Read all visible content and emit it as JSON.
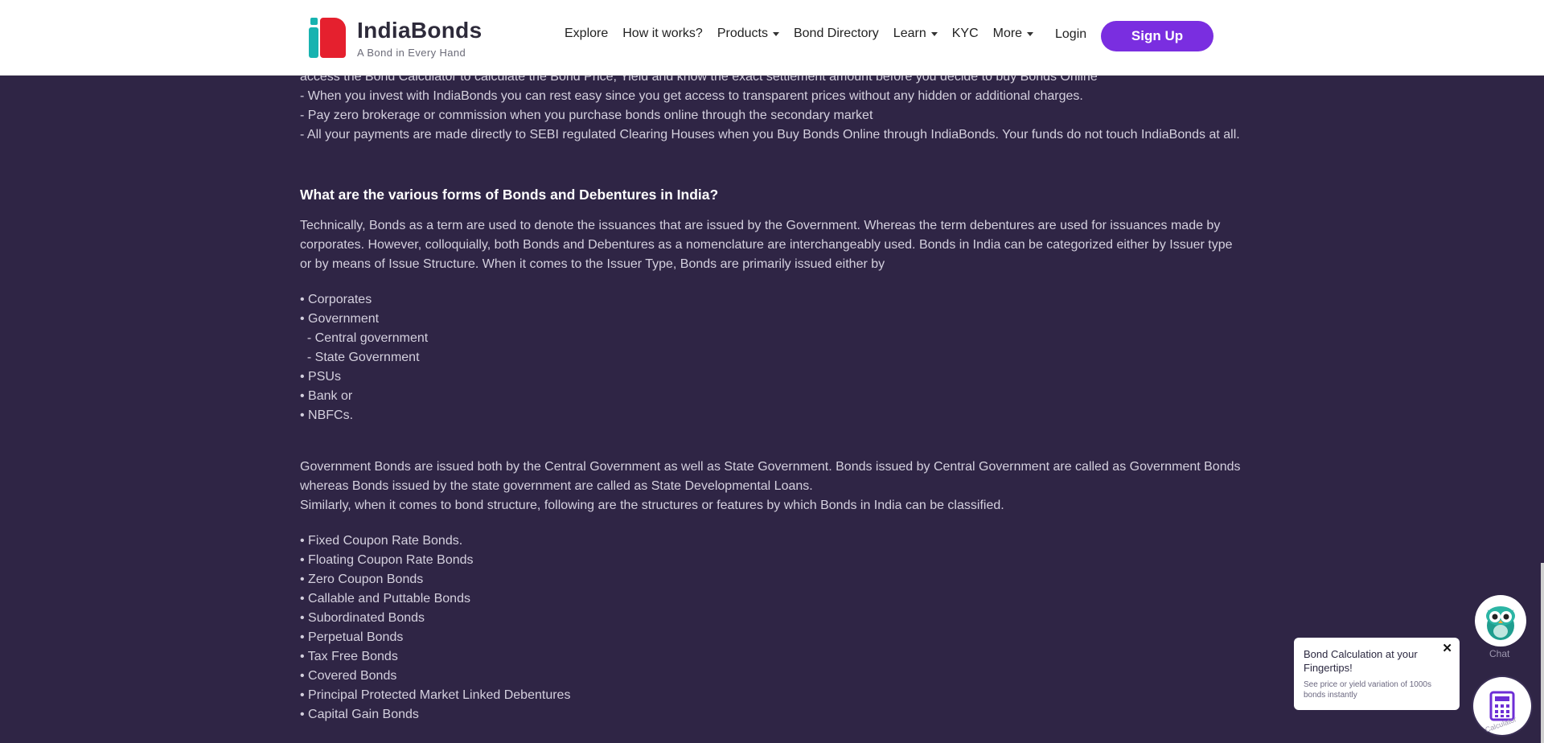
{
  "header": {
    "brand": "IndiaBonds",
    "tagline": "A Bond in Every Hand",
    "nav": [
      {
        "label": "Explore",
        "dropdown": false
      },
      {
        "label": "How it works?",
        "dropdown": false
      },
      {
        "label": "Products",
        "dropdown": true
      },
      {
        "label": "Bond Directory",
        "dropdown": false
      },
      {
        "label": "Learn",
        "dropdown": true
      },
      {
        "label": "KYC",
        "dropdown": false
      },
      {
        "label": "More",
        "dropdown": true
      }
    ],
    "login": "Login",
    "signup": "Sign Up",
    "colors": {
      "accent": "#7a2ee0",
      "logo_red": "#e5202e",
      "logo_teal": "#17b3b0"
    }
  },
  "content": {
    "intro_lines": [
      "access the Bond Calculator to calculate the Bond Price, Yield and know the exact settlement amount before you decide to buy Bonds Online",
      "- When you invest with IndiaBonds you can rest easy since you get access to transparent prices without any hidden or additional charges.",
      "- Pay zero brokerage or commission when you purchase bonds online through the secondary market",
      "- All your payments are made directly to SEBI regulated Clearing Houses when you Buy Bonds Online through IndiaBonds. Your funds do not touch IndiaBonds at all."
    ],
    "heading": "What are the various forms of Bonds and Debentures in India?",
    "para1": "Technically, Bonds as a term are used to denote the issuances that are issued by the Government. Whereas the term debentures are used for issuances made by corporates. However, colloquially, both Bonds and Debentures as a nomenclature are interchangeably used. Bonds in India can be categorized either by Issuer type or by means of Issue Structure. When it comes to the Issuer Type, Bonds are primarily issued either by",
    "issuer_list": [
      "• Corporates",
      "• Government",
      "  - Central government",
      "  - State Government",
      "• PSUs",
      "• Bank or",
      "• NBFCs."
    ],
    "para2": "Government Bonds are issued both by the Central Government as well as State Government. Bonds issued by Central Government are called as Government Bonds whereas Bonds issued by the state government are called as State Developmental Loans.",
    "para3": "Similarly, when it comes to bond structure, following are the structures or features by which Bonds in India can be classified.",
    "structure_list": [
      "• Fixed Coupon Rate Bonds.",
      "• Floating Coupon Rate Bonds",
      "• Zero Coupon Bonds",
      "• Callable and Puttable Bonds",
      "• Subordinated Bonds",
      "• Perpetual Bonds",
      "• Tax Free Bonds",
      "• Covered Bonds",
      "• Principal Protected Market Linked Debentures",
      "• Capital Gain Bonds"
    ]
  },
  "widgets": {
    "chat_label": "Chat",
    "tip_title": "Bond Calculation at your Fingertips!",
    "tip_sub": "See price or yield variation of 1000s bonds instantly",
    "tip_close": "✕",
    "calc_label": "Calculator"
  }
}
